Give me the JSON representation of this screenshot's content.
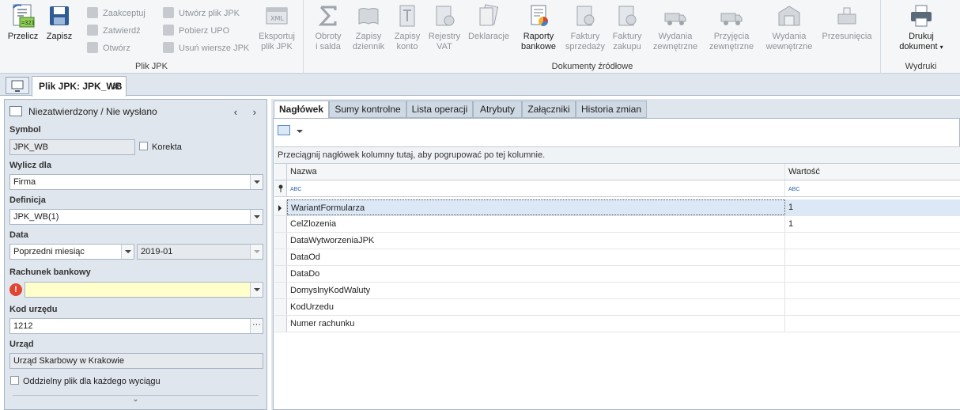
{
  "ribbon": {
    "groups": {
      "plik_jpk": "Plik JPK",
      "dokumenty_zrodlowe": "Dokumenty źródłowe",
      "wydruki": "Wydruki"
    },
    "buttons": {
      "przelicz": "Przelicz",
      "zapisz": "Zapisz",
      "zaakceptuj": "Zaakceptuj",
      "zatwierdz": "Zatwierdź",
      "otworz": "Otwórz",
      "utworz_plik": "Utwórz plik JPK",
      "pobierz_upo": "Pobierz UPO",
      "usun_wiersze": "Usuń wiersze JPK",
      "eksportuj_1": "Eksportuj",
      "eksportuj_2": "plik JPK",
      "obroty_1": "Obroty",
      "obroty_2": "i salda",
      "zapisy_dziennik_1": "Zapisy",
      "zapisy_dziennik_2": "dziennik",
      "zapisy_konto_1": "Zapisy",
      "zapisy_konto_2": "konto",
      "rejestry_1": "Rejestry",
      "rejestry_2": "VAT",
      "deklaracje": "Deklaracje",
      "raporty_1": "Raporty",
      "raporty_2": "bankowe",
      "faktury_sprz_1": "Faktury",
      "faktury_sprz_2": "sprzedaży",
      "faktury_zak_1": "Faktury",
      "faktury_zak_2": "zakupu",
      "wydania_zew_1": "Wydania",
      "wydania_zew_2": "zewnętrzne",
      "przyjecia_1": "Przyjęcia",
      "przyjecia_2": "zewnętrzne",
      "wydania_wew_1": "Wydania",
      "wydania_wew_2": "wewnętrzne",
      "przesuniecia": "Przesunięcia",
      "drukuj_1": "Drukuj",
      "drukuj_2": "dokument"
    }
  },
  "doc_tab": {
    "title": "Plik JPK: JPK_WB",
    "close": "✕"
  },
  "left": {
    "status": "Niezatwierdzony / Nie wysłano",
    "nav": "‹ ›",
    "symbol_label": "Symbol",
    "symbol_value": "JPK_WB",
    "korekta_label": "Korekta",
    "wylicz_label": "Wylicz dla",
    "wylicz_value": "Firma",
    "definicja_label": "Definicja",
    "definicja_value": "JPK_WB(1)",
    "data_label": "Data",
    "data_period": "Poprzedni miesiąc",
    "data_value": "2019-01",
    "rachunek_label": "Rachunek bankowy",
    "rachunek_value": "",
    "kod_label": "Kod urzędu",
    "kod_value": "1212",
    "urzad_label": "Urząd",
    "urzad_value": "Urząd Skarbowy w Krakowie",
    "oddzielny_label": "Oddzielny plik dla każdego wyciągu",
    "collapse": "⌄"
  },
  "tabs": [
    "Nagłówek",
    "Sumy kontrolne",
    "Lista operacji",
    "Atrybuty",
    "Załączniki",
    "Historia zmian"
  ],
  "grid": {
    "group_hint": "Przeciągnij nagłówek kolumny tutaj, aby pogrupować po tej kolumnie.",
    "col_nazwa": "Nazwa",
    "col_wartosc": "Wartość",
    "filter_glyph": "ABC",
    "rows": [
      {
        "name": "WariantFormularza",
        "value": "1"
      },
      {
        "name": "CelZlozenia",
        "value": "1"
      },
      {
        "name": "DataWytworzeniaJPK",
        "value": ""
      },
      {
        "name": "DataOd",
        "value": ""
      },
      {
        "name": "DataDo",
        "value": ""
      },
      {
        "name": "DomyslnyKodWaluty",
        "value": ""
      },
      {
        "name": "KodUrzedu",
        "value": ""
      },
      {
        "name": "Numer rachunku",
        "value": ""
      }
    ]
  },
  "colors": {
    "accent": "#2b63ad",
    "panel": "#dfe6ee",
    "selected_row": "#dce8f6",
    "required_field": "#ffffcc",
    "error": "#e0462f"
  }
}
